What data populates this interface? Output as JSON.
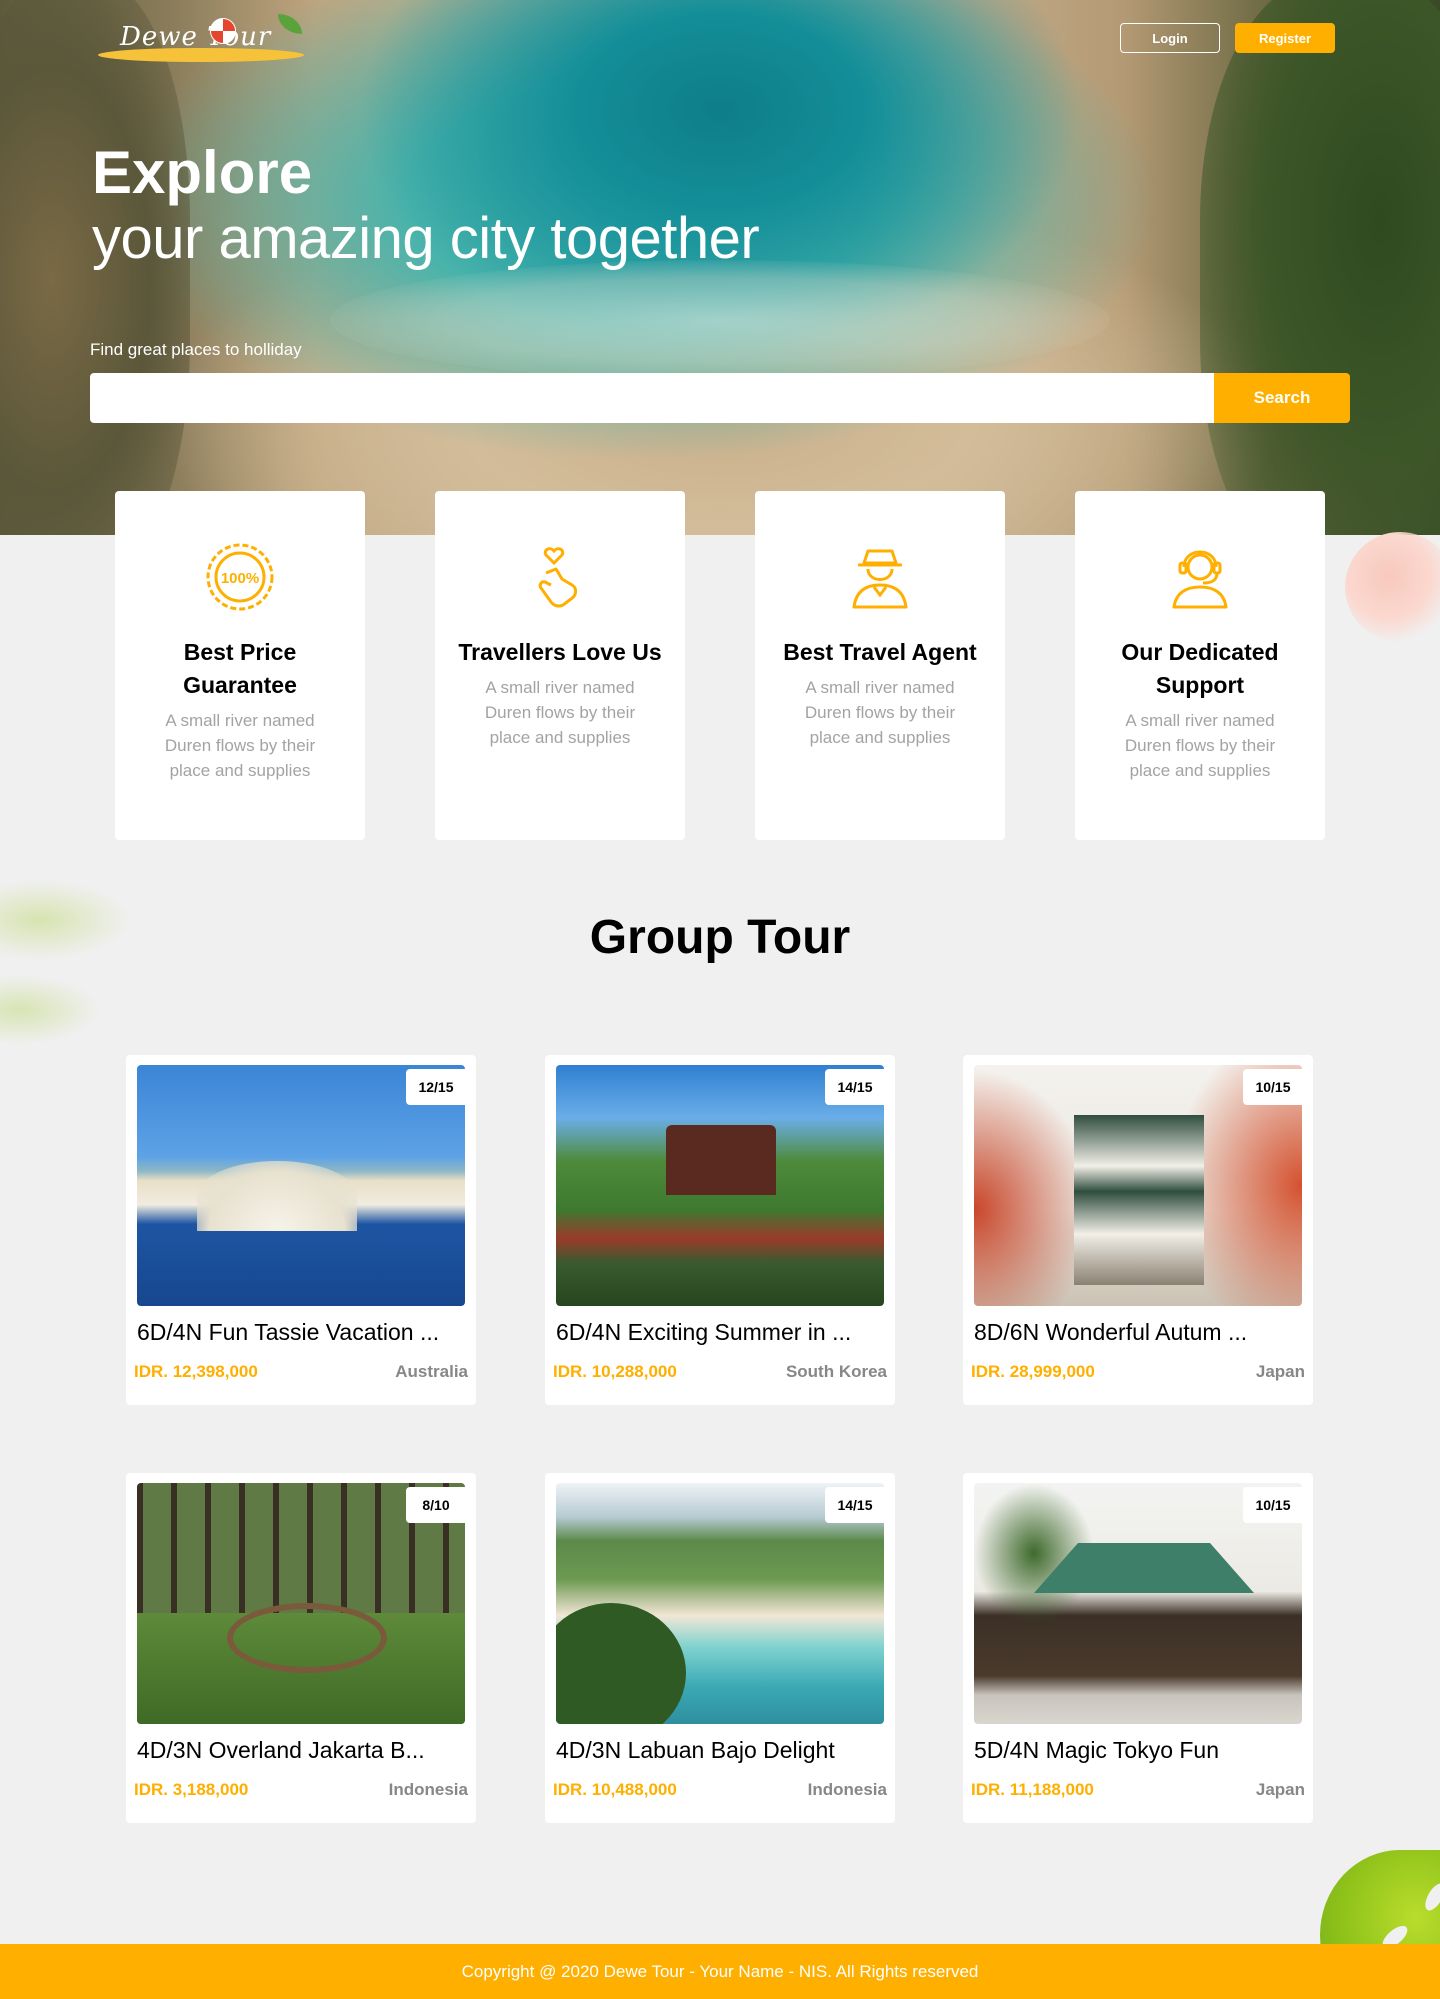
{
  "brand": {
    "logo_text": "Dewe Tour",
    "accent": "#ffaf00"
  },
  "nav": {
    "login_label": "Login",
    "register_label": "Register"
  },
  "hero": {
    "title": "Explore",
    "subtitle": "your amazing city together",
    "find_label": "Find great places to holliday",
    "search_value": "",
    "search_button": "Search"
  },
  "features": [
    {
      "icon": "guarantee-100-icon",
      "title": "Best Price Guarantee",
      "description": "A small river named Duren flows by their place and supplies"
    },
    {
      "icon": "heart-hand-icon",
      "title": "Travellers Love Us",
      "description": "A small river named Duren flows by their place and supplies"
    },
    {
      "icon": "agent-icon",
      "title": "Best Travel Agent",
      "description": "A small river named Duren flows by their place and supplies"
    },
    {
      "icon": "support-headset-icon",
      "title": "Our Dedicated Support",
      "description": "A small river named Duren flows by their place and supplies"
    }
  ],
  "group_tour": {
    "title": "Group Tour",
    "tours": [
      {
        "name": "6D/4N Fun Tassie Vacation ...",
        "price": "IDR. 12,398,000",
        "country": "Australia",
        "quota": "12/15"
      },
      {
        "name": "6D/4N Exciting Summer in ...",
        "price": "IDR. 10,288,000",
        "country": "South Korea",
        "quota": "14/15"
      },
      {
        "name": "8D/6N Wonderful Autum ...",
        "price": "IDR. 28,999,000",
        "country": "Japan",
        "quota": "10/15"
      },
      {
        "name": "4D/3N Overland Jakarta B...",
        "price": "IDR. 3,188,000",
        "country": "Indonesia",
        "quota": "8/10"
      },
      {
        "name": "4D/3N Labuan Bajo Delight",
        "price": "IDR. 10,488,000",
        "country": "Indonesia",
        "quota": "14/15"
      },
      {
        "name": "5D/4N Magic Tokyo Fun",
        "price": "IDR. 11,188,000",
        "country": "Japan",
        "quota": "10/15"
      }
    ]
  },
  "footer": {
    "copyright": "Copyright @ 2020 Dewe Tour - Your Name - NIS. All Rights reserved"
  }
}
